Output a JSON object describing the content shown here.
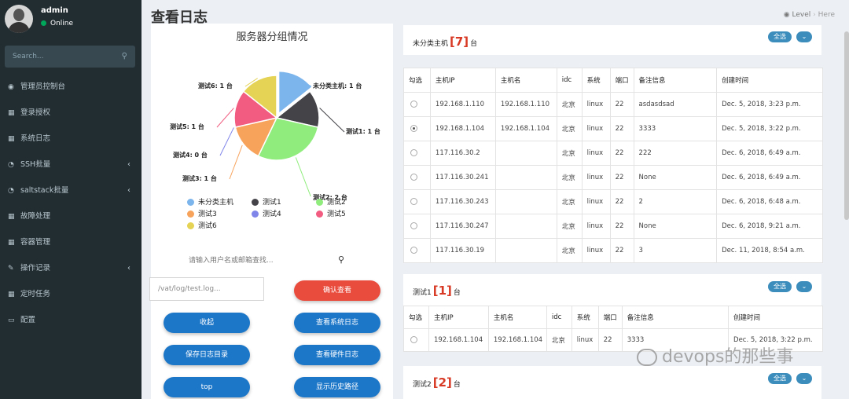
{
  "user": {
    "name": "admin",
    "status": "Online"
  },
  "sidebar": {
    "search_placeholder": "Search...",
    "items": [
      {
        "label": "管理员控制台",
        "icon": "dashboard-icon",
        "glyph": "◉",
        "has_children": false
      },
      {
        "label": "登录授权",
        "icon": "grid-icon",
        "glyph": "▦",
        "has_children": false
      },
      {
        "label": "系统日志",
        "icon": "grid-icon",
        "glyph": "▦",
        "has_children": false
      },
      {
        "label": "SSH批量",
        "icon": "pie-chart-icon",
        "glyph": "◔",
        "has_children": true
      },
      {
        "label": "saltstack批量",
        "icon": "pie-chart-icon",
        "glyph": "◔",
        "has_children": true
      },
      {
        "label": "故障处理",
        "icon": "grid-icon",
        "glyph": "▦",
        "has_children": false
      },
      {
        "label": "容器管理",
        "icon": "grid-icon",
        "glyph": "▦",
        "has_children": false
      },
      {
        "label": "操作记录",
        "icon": "edit-icon",
        "glyph": "✎",
        "has_children": true
      },
      {
        "label": "定时任务",
        "icon": "grid-icon",
        "glyph": "▦",
        "has_children": false
      },
      {
        "label": "配置",
        "icon": "laptop-icon",
        "glyph": "▭",
        "has_children": false
      }
    ]
  },
  "page": {
    "title": "查看日志",
    "breadcrumb_level": "Level",
    "breadcrumb_here": "Here"
  },
  "chart_data": {
    "type": "pie",
    "title": "服务器分组情况",
    "series": [
      {
        "name": "未分类主机",
        "value": 1,
        "label": "未分类主机: 1 台",
        "color": "#7cb5ec"
      },
      {
        "name": "测试1",
        "value": 1,
        "label": "测试1: 1 台",
        "color": "#434348"
      },
      {
        "name": "测试2",
        "value": 2,
        "label": "测试2: 2 台",
        "color": "#90ed7d"
      },
      {
        "name": "测试3",
        "value": 1,
        "label": "测试3: 1 台",
        "color": "#f7a35c"
      },
      {
        "name": "测试4",
        "value": 0,
        "label": "测试4: 0 台",
        "color": "#8085e9"
      },
      {
        "name": "测试5",
        "value": 1,
        "label": "测试5: 1 台",
        "color": "#f15c80"
      },
      {
        "name": "测试6",
        "value": 1,
        "label": "测试6: 1 台",
        "color": "#e4d354"
      }
    ]
  },
  "user_search": {
    "placeholder": "请输入用户名或邮箱查找..."
  },
  "log_path": {
    "placeholder": "/vat/log/test.log..."
  },
  "buttons": {
    "confirm_view": "确认查看",
    "collapse": "收起",
    "view_system_log": "查看系统日志",
    "save_log_dir": "保存日志目录",
    "view_hardware_log": "查看硬件日志",
    "top": "top",
    "show_history_path": "显示历史路径"
  },
  "groups": [
    {
      "name": "未分类主机",
      "count": "[7]",
      "unit": "台",
      "select_all": "全选",
      "collapse": "⌄",
      "columns": [
        "勾选",
        "主机IP",
        "主机名",
        "idc",
        "系统",
        "端口",
        "备注信息",
        "创建时间"
      ],
      "rows": [
        {
          "checked": false,
          "ip": "192.168.1.110",
          "hostname": "192.168.1.110",
          "idc": "北京",
          "os": "linux",
          "port": "22",
          "note": "asdasdsad",
          "created": "Dec. 5, 2018, 3:23 p.m."
        },
        {
          "checked": true,
          "ip": "192.168.1.104",
          "hostname": "192.168.1.104",
          "idc": "北京",
          "os": "linux",
          "port": "22",
          "note": "3333",
          "created": "Dec. 5, 2018, 3:22 p.m."
        },
        {
          "checked": false,
          "ip": "117.116.30.2",
          "hostname": "",
          "idc": "北京",
          "os": "linux",
          "port": "22",
          "note": "222",
          "created": "Dec. 6, 2018, 6:49 a.m."
        },
        {
          "checked": false,
          "ip": "117.116.30.241",
          "hostname": "",
          "idc": "北京",
          "os": "linux",
          "port": "22",
          "note": "None",
          "created": "Dec. 6, 2018, 6:49 a.m."
        },
        {
          "checked": false,
          "ip": "117.116.30.243",
          "hostname": "",
          "idc": "北京",
          "os": "linux",
          "port": "22",
          "note": "2",
          "created": "Dec. 6, 2018, 6:48 a.m."
        },
        {
          "checked": false,
          "ip": "117.116.30.247",
          "hostname": "",
          "idc": "北京",
          "os": "linux",
          "port": "22",
          "note": "None",
          "created": "Dec. 6, 2018, 9:21 a.m."
        },
        {
          "checked": false,
          "ip": "117.116.30.19",
          "hostname": "",
          "idc": "北京",
          "os": "linux",
          "port": "22",
          "note": "3",
          "created": "Dec. 11, 2018, 8:54 a.m."
        }
      ]
    },
    {
      "name": "测试1",
      "count": "[1]",
      "unit": "台",
      "select_all": "全选",
      "collapse": "⌄",
      "columns": [
        "勾选",
        "主机IP",
        "主机名",
        "idc",
        "系统",
        "端口",
        "备注信息",
        "创建时间"
      ],
      "rows": [
        {
          "checked": false,
          "ip": "192.168.1.104",
          "hostname": "192.168.1.104",
          "idc": "北京",
          "os": "linux",
          "port": "22",
          "note": "3333",
          "created": "Dec. 5, 2018, 3:22 p.m."
        }
      ]
    },
    {
      "name": "测试2",
      "count": "[2]",
      "unit": "台",
      "select_all": "全选",
      "collapse": "⌄"
    }
  ],
  "watermark": "devops的那些事"
}
